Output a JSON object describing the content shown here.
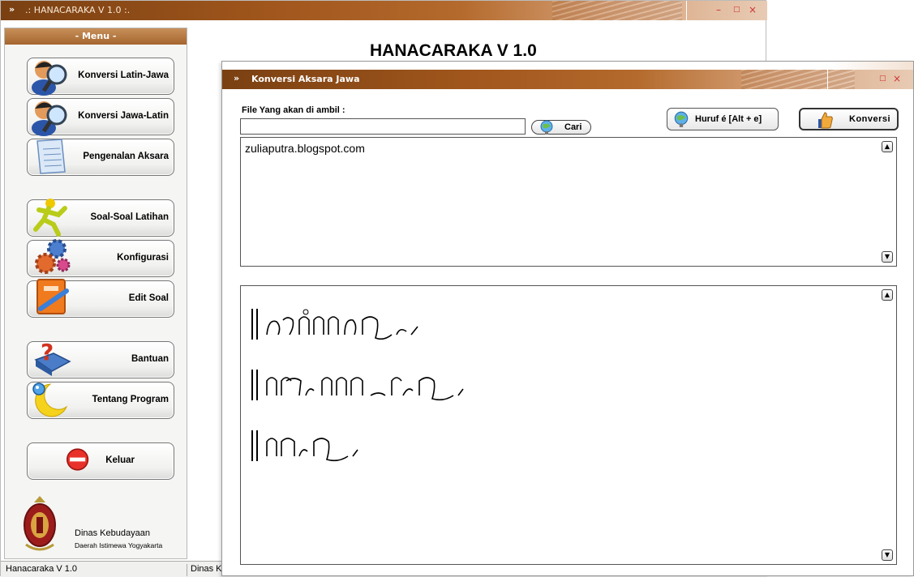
{
  "main_window": {
    "title": ".: HANACARAKA V 1.0 :.",
    "app_heading": "HANACARAKA V 1.0"
  },
  "sidebar": {
    "header": "- Menu -",
    "items": [
      {
        "label": "Konversi Latin-Jawa",
        "icon": "user-search-icon"
      },
      {
        "label": "Konversi Jawa-Latin",
        "icon": "user-search-icon"
      },
      {
        "label": "Pengenalan Aksara",
        "icon": "document-icon"
      },
      {
        "label": "Soal-Soal Latihan",
        "icon": "running-person-icon"
      },
      {
        "label": "Konfigurasi",
        "icon": "gears-icon"
      },
      {
        "label": "Edit Soal",
        "icon": "book-edit-icon"
      },
      {
        "label": "Bantuan",
        "icon": "help-book-icon"
      },
      {
        "label": "Tentang Program",
        "icon": "moon-icon"
      },
      {
        "label": "Keluar",
        "icon": "stop-icon"
      }
    ],
    "org_name": "Dinas Kebudayaan",
    "org_region": "Daerah Istimewa Yogyakarta"
  },
  "statusbar": {
    "panel1": "Hanacaraka V 1.0",
    "panel2": "Dinas K"
  },
  "dialog": {
    "title": "Konversi Aksara Jawa",
    "file_label": "File Yang akan di ambil :",
    "file_value": "",
    "browse_label": "Cari",
    "huruf_label": "Huruf é [Alt + e]",
    "convert_label": "Konversi",
    "input_text": "zuliaputra.blogspot.com"
  },
  "colors": {
    "titlebar": "#a0561c",
    "menu_header": "#b8743a"
  }
}
